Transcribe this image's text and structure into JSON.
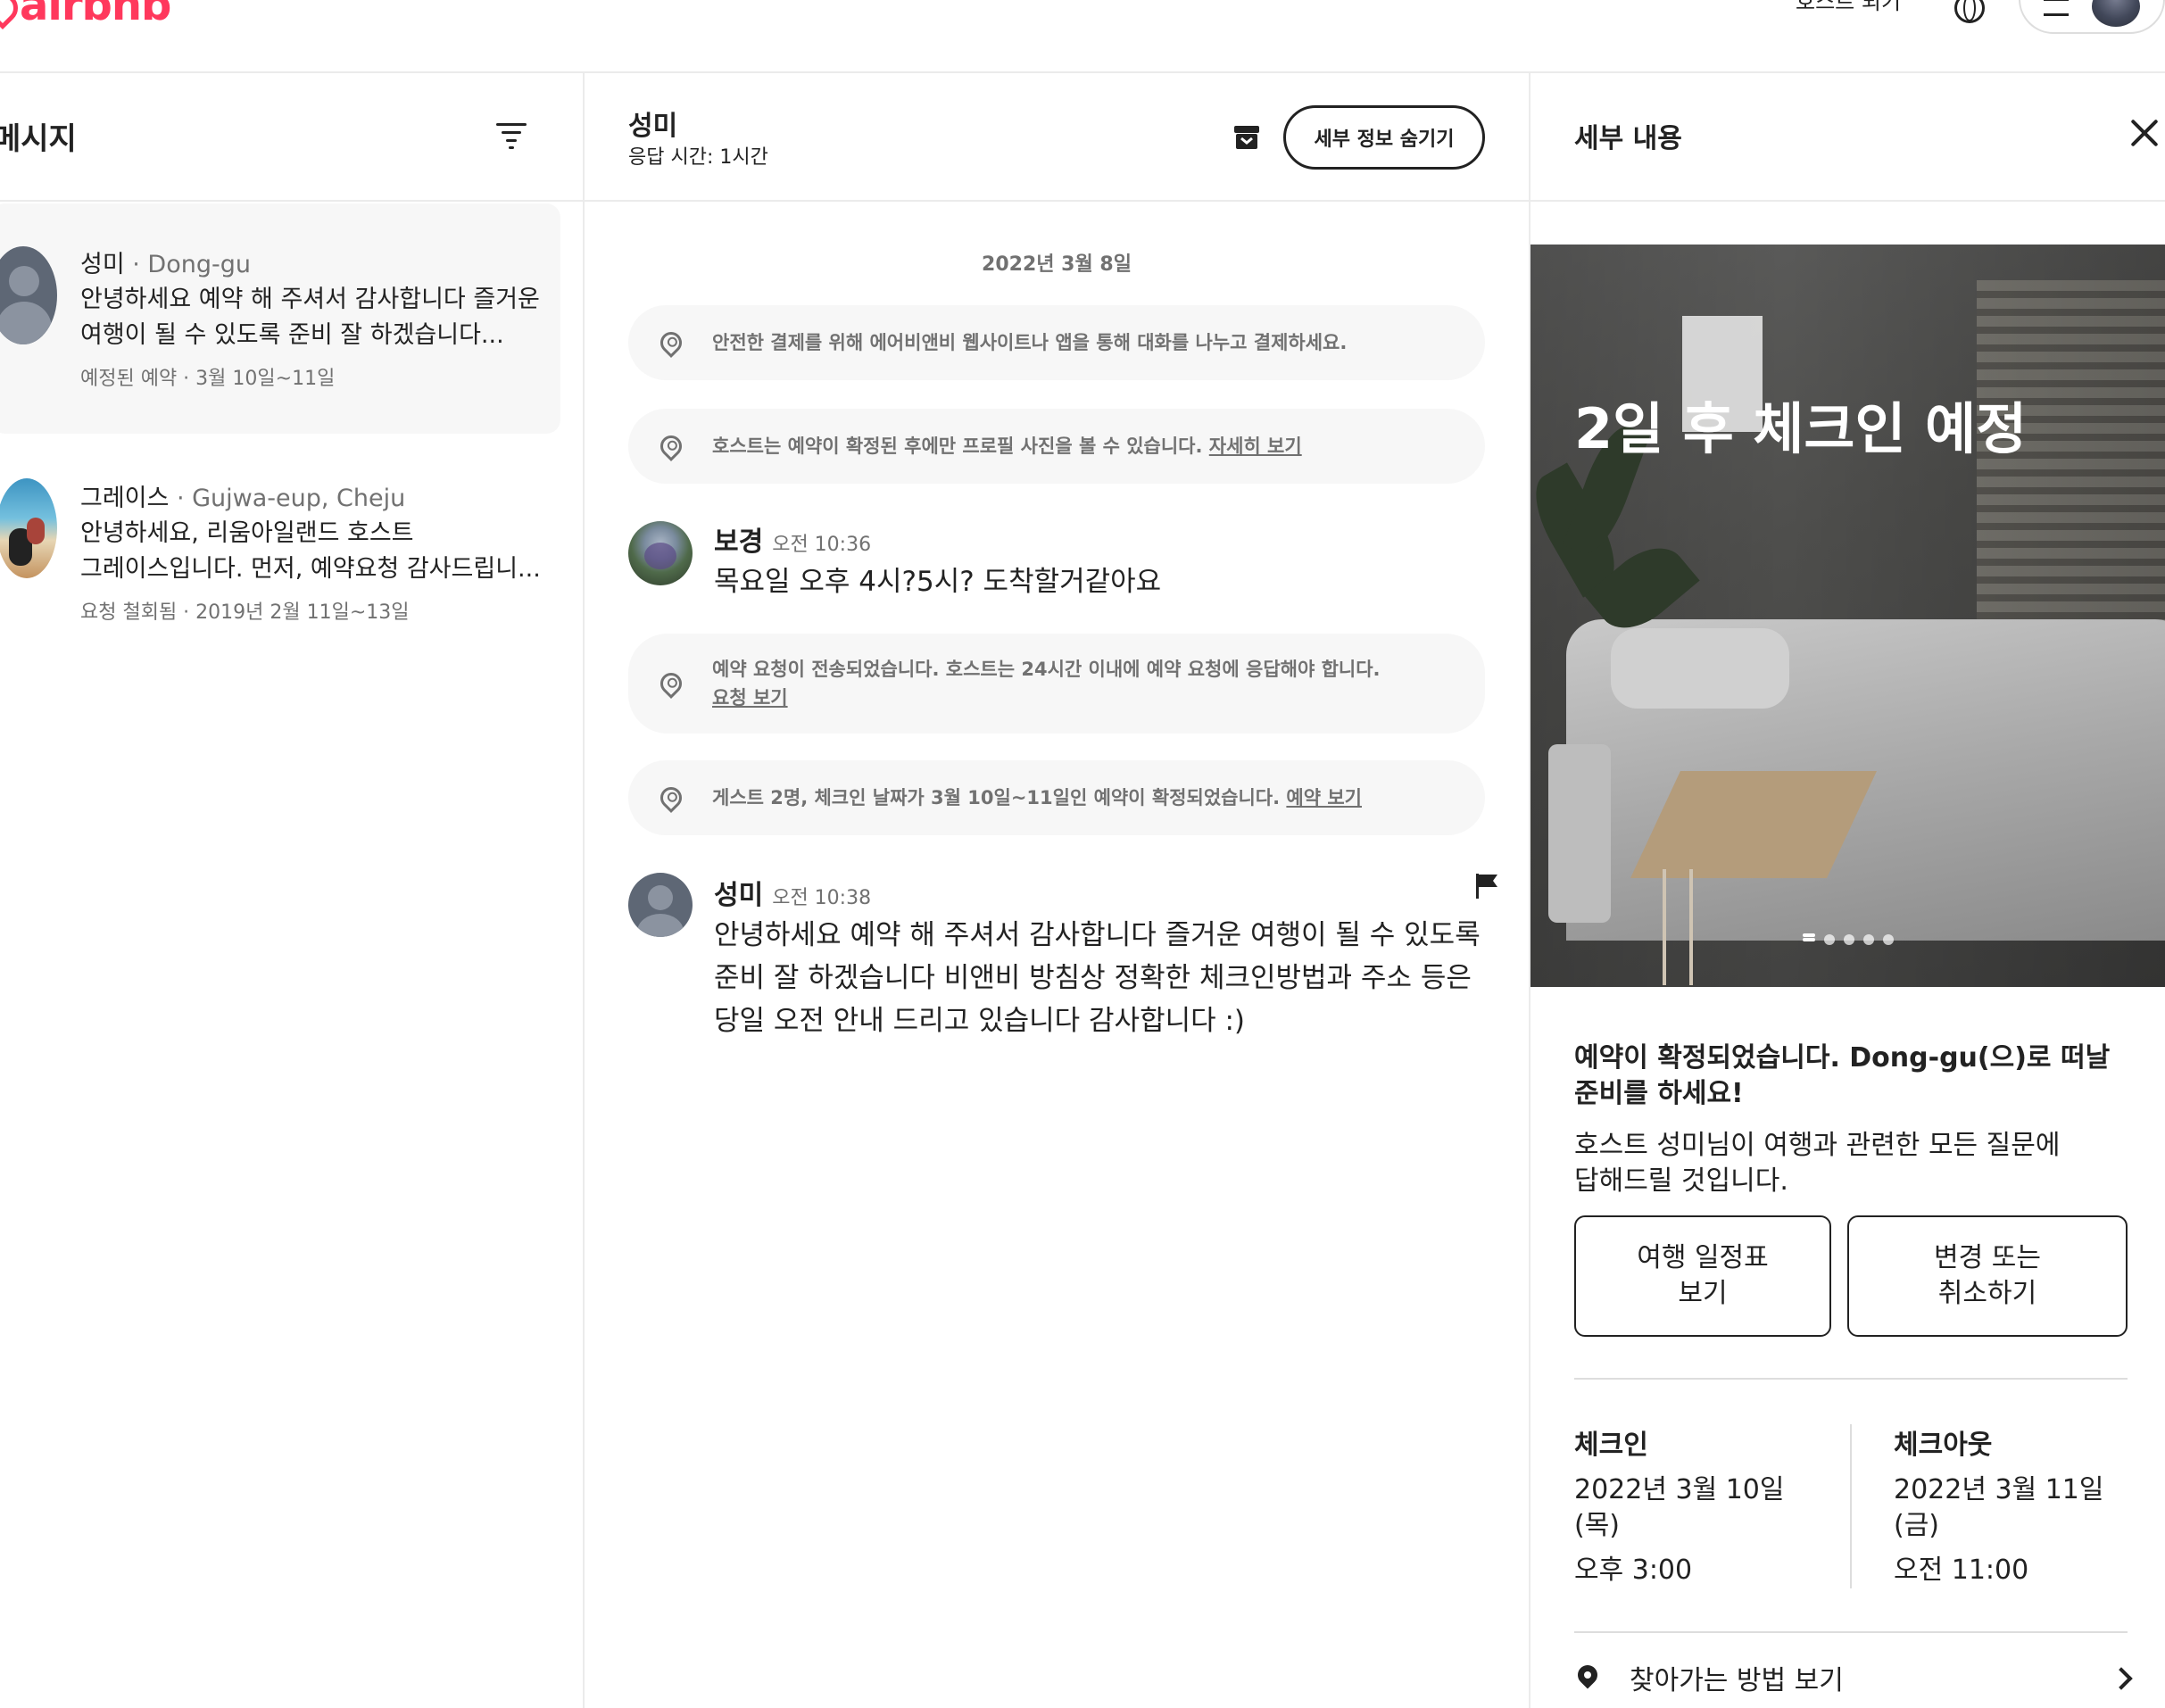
{
  "header": {
    "logo_text": "airbnb",
    "host_link": "호스트 되기",
    "brand_color": "#ff385c"
  },
  "inbox": {
    "title": "메시지",
    "conversations": [
      {
        "name": "성미",
        "location": " · Dong-gu",
        "preview_line1": "안녕하세요 예약 해 주셔서 감사합니다 즐거운",
        "preview_line2": "여행이 될 수 있도록 준비 잘 하겠습니다...",
        "meta": "예정된 예약 · 3월 10일~11일"
      },
      {
        "name": "그레이스",
        "location": " · Gujwa-eup, Cheju",
        "preview_line1": "안녕하세요, 리움아일랜드 호스트",
        "preview_line2": "그레이스입니다. 먼저, 예약요청 감사드립니...",
        "meta": "요청 철회됨 · 2019년 2월 11일~13일"
      }
    ]
  },
  "chat": {
    "name": "성미",
    "response_time": "응답 시간: 1시간",
    "hide_details_button": "세부 정보 숨기기",
    "date": "2022년 3월 8일",
    "system_messages": [
      {
        "text": "안전한 결제를 위해 에어비앤비 웹사이트나 앱을 통해 대화를 나누고 결제하세요.",
        "link": ""
      },
      {
        "text": "호스트는 예약이 확정된 후에만 프로필 사진을 볼 수 있습니다. ",
        "link": "자세히 보기"
      },
      {
        "text": "예약 요청이 전송되었습니다. 호스트는 24시간 이내에 예약 요청에 응답해야 합니다.",
        "link": "요청 보기"
      },
      {
        "text": "게스트 2명, 체크인 날짜가 3월 10일~11일인 예약이 확정되었습니다. ",
        "link": "예약 보기"
      }
    ],
    "messages": [
      {
        "sender": "보경",
        "time": "오전 10:36",
        "lines": [
          "목요일 오후 4시?5시? 도착할거같아요"
        ]
      },
      {
        "sender": "성미",
        "time": "오전 10:38",
        "lines": [
          "안녕하세요 예약 해 주셔서 감사합니다 즐거운 여행이 될 수 있도록",
          "준비 잘 하겠습니다 비앤비 방침상 정확한 체크인방법과 주소 등은",
          "당일 오전 안내 드리고 있습니다 감사합니다 :)"
        ]
      }
    ]
  },
  "details": {
    "title": "세부 내용",
    "photo_heading": "2일 후 체크인 예정",
    "photo_count": 5,
    "photo_active_index": 0,
    "confirm_line1": "예약이 확정되었습니다. Dong-gu(으)로 떠날",
    "confirm_line2": "준비를 하세요!",
    "host_line1": "호스트 성미님이 여행과 관련한 모든 질문에",
    "host_line2": "답해드릴 것입니다.",
    "itinerary_button_line1": "여행 일정표",
    "itinerary_button_line2": "보기",
    "change_button_line1": "변경 또는",
    "change_button_line2": "취소하기",
    "checkin": {
      "label": "체크인",
      "date_line1": "2022년 3월 10일",
      "date_line2": "(목)",
      "time": "오후 3:00"
    },
    "checkout": {
      "label": "체크아웃",
      "date_line1": "2022년 3월 11일",
      "date_line2": "(금)",
      "time": "오전 11:00"
    },
    "directions": "찾아가는 방법 보기"
  }
}
